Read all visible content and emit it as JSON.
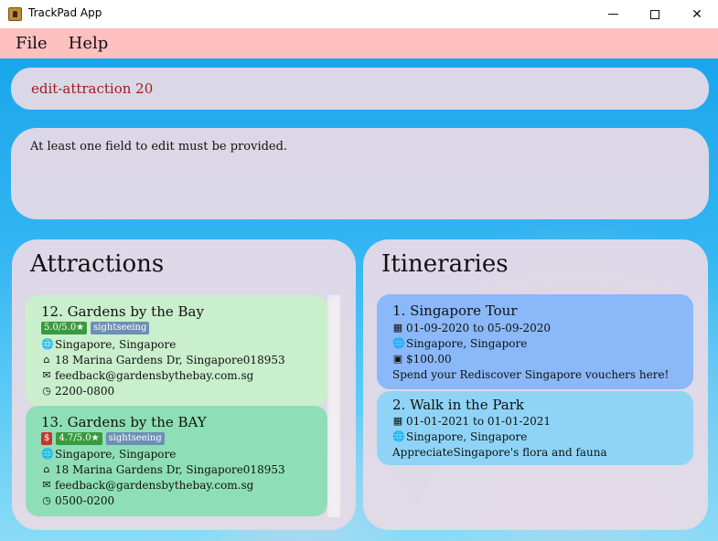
{
  "window": {
    "title": "TrackPad App"
  },
  "menu": {
    "file": "File",
    "help": "Help"
  },
  "command": {
    "text": "edit-attraction 20"
  },
  "result": {
    "text": "At least one field to edit must be provided."
  },
  "attractions": {
    "title": "Attractions",
    "items": [
      {
        "index_name": "12.  Gardens by the Bay",
        "rating": "5.0/5.0★",
        "tag": "sightseeing",
        "location": "Singapore, Singapore",
        "address": "18 Marina Gardens Dr, Singapore018953",
        "email": "feedback@gardensbythebay.com.sg",
        "hours": "2200-0800",
        "card_color": "#c9efcd"
      },
      {
        "index_name": "13.  Gardens by the BAY",
        "price": "$",
        "rating": "4.7/5.0★",
        "tag": "sightseeing",
        "location": "Singapore, Singapore",
        "address": "18 Marina Gardens Dr, Singapore018953",
        "email": "feedback@gardensbythebay.com.sg",
        "hours": "0500-0200",
        "card_color": "#8edfb8"
      }
    ]
  },
  "itineraries": {
    "title": "Itineraries",
    "items": [
      {
        "index_name": "1.  Singapore Tour",
        "dates": "01-09-2020 to 05-09-2020",
        "location": "Singapore, Singapore",
        "budget": "$100.00",
        "description": "Spend your Rediscover Singapore vouchers here!",
        "card_color": "#8ab8f8"
      },
      {
        "index_name": "2.  Walk in the Park",
        "dates": "01-01-2021 to 01-01-2021",
        "location": "Singapore, Singapore",
        "description": "AppreciateSingapore's flora and fauna",
        "card_color": "#8fd4f6"
      }
    ]
  },
  "icons": {
    "location": "globe-icon",
    "address": "home-icon",
    "email": "envelope-icon",
    "hours": "clock-icon",
    "dates": "calendar-icon",
    "budget": "money-icon"
  },
  "colors": {
    "menu_bar": "#ffc0c0",
    "command_text": "#a01c1c",
    "rating_tag": "#3a9a3e",
    "type_tag": "#6d8fb4",
    "price_tag": "#c0392b"
  }
}
